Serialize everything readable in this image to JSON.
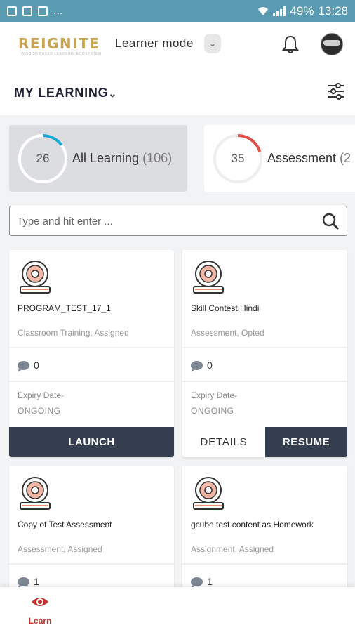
{
  "status_bar": {
    "left_text": "...",
    "battery": "49%",
    "time": "13:28"
  },
  "header": {
    "logo": "REIGNITE",
    "logo_subtitle": "WISDOM BASED LEARNING ECOSYSTEM",
    "mode": "Learner mode"
  },
  "section": {
    "title": "MY LEARNING"
  },
  "summary": [
    {
      "count": "26",
      "label": "All Learning",
      "total": "(106)",
      "progress": 0.15,
      "color": "#1ba8d5"
    },
    {
      "count": "35",
      "label": "Assessment",
      "total": "(2",
      "progress": 0.2,
      "color": "#e2504a"
    }
  ],
  "search": {
    "placeholder": "Type and hit enter ..."
  },
  "cards": [
    {
      "title": "PROGRAM_TEST_17_1",
      "type": "Classroom Training, Assigned",
      "comments": "0",
      "expiry_label": "Expiry Date-",
      "expiry_value": "ONGOING",
      "buttons": [
        "LAUNCH"
      ]
    },
    {
      "title": "Skill Contest Hindi",
      "type": "Assessment, Opted",
      "comments": "0",
      "expiry_label": "Expiry Date-",
      "expiry_value": "ONGOING",
      "buttons": [
        "DETAILS",
        "RESUME"
      ]
    },
    {
      "title": "Copy of Test Assessment",
      "type": "Assessment, Assigned",
      "comments": "1"
    },
    {
      "title": "gcube test content as Homework",
      "type": "Assignment, Assigned",
      "comments": "1"
    }
  ],
  "bottom_nav": {
    "items": [
      {
        "label": "Learn",
        "icon": "eye-icon",
        "active": true,
        "color": "#c4352f"
      }
    ]
  }
}
